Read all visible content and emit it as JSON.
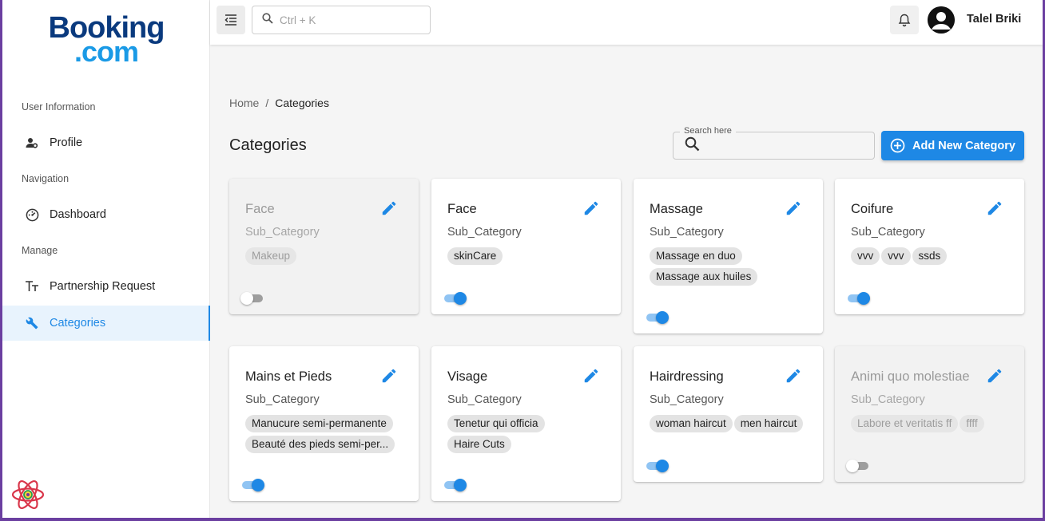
{
  "logo": {
    "line1": "Booking",
    "line2": ".com"
  },
  "sidebar": {
    "sections": [
      {
        "label": "User Information"
      },
      {
        "label": "Navigation"
      },
      {
        "label": "Manage"
      }
    ],
    "items": [
      {
        "label": "Profile",
        "icon": "user-gear-icon"
      },
      {
        "label": "Dashboard",
        "icon": "dashboard-icon"
      },
      {
        "label": "Partnership Request",
        "icon": "text-format-icon"
      },
      {
        "label": "Categories",
        "icon": "wrench-icon",
        "active": true
      }
    ]
  },
  "topbar": {
    "search_placeholder": "Ctrl + K",
    "username": "Talel Briki"
  },
  "breadcrumb": {
    "home": "Home",
    "separator": "/",
    "current": "Categories"
  },
  "page": {
    "title": "Categories",
    "search_label": "Search here",
    "add_button": "Add New Category"
  },
  "colors": {
    "primary": "#1e88e5",
    "brand_dark": "#0a3a7e",
    "brand_light": "#1a9ae6"
  },
  "cards": [
    {
      "title": "Face",
      "sub": "Sub_Category",
      "chips": [
        "Makeup"
      ],
      "enabled": false
    },
    {
      "title": "Face",
      "sub": "Sub_Category",
      "chips": [
        "skinCare"
      ],
      "enabled": true
    },
    {
      "title": "Massage",
      "sub": "Sub_Category",
      "chips": [
        "Massage en duo",
        "Massage aux huiles"
      ],
      "enabled": true
    },
    {
      "title": "Coifure",
      "sub": "Sub_Category",
      "chips": [
        "vvv",
        "vvv",
        "ssds"
      ],
      "enabled": true
    },
    {
      "title": "Mains et Pieds",
      "sub": "Sub_Category",
      "chips": [
        "Manucure semi-permanente",
        "Beauté des pieds semi-per..."
      ],
      "enabled": true
    },
    {
      "title": "Visage",
      "sub": "Sub_Category",
      "chips": [
        "Tenetur qui officia",
        "Haire Cuts"
      ],
      "enabled": true
    },
    {
      "title": "Hairdressing",
      "sub": "Sub_Category",
      "chips": [
        "woman haircut",
        "men haircut"
      ],
      "enabled": true
    },
    {
      "title": "Animi quo molestiae",
      "sub": "Sub_Category",
      "chips": [
        "Labore et veritatis ff",
        "ffff"
      ],
      "enabled": false
    }
  ]
}
